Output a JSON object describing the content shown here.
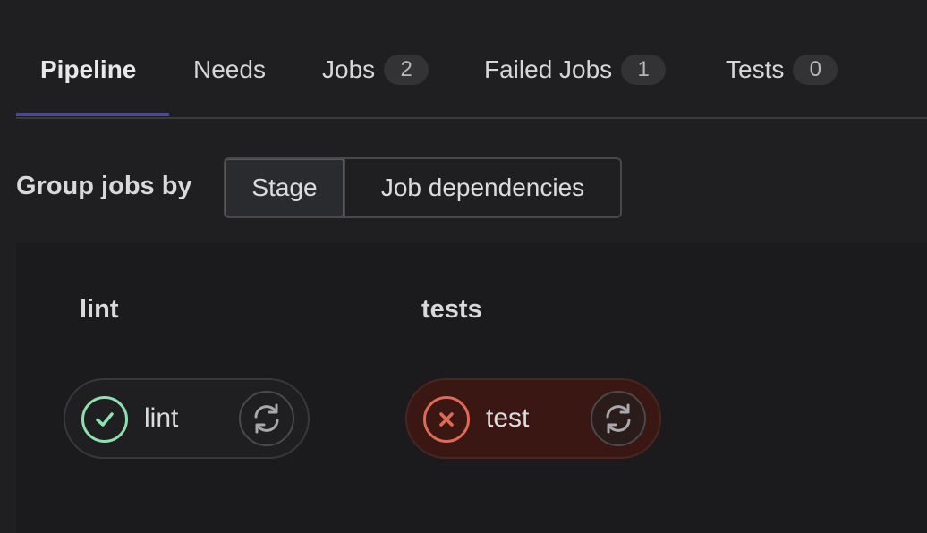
{
  "tabs": [
    {
      "label": "Pipeline",
      "active": true
    },
    {
      "label": "Needs"
    },
    {
      "label": "Jobs",
      "count": "2"
    },
    {
      "label": "Failed Jobs",
      "count": "1"
    },
    {
      "label": "Tests",
      "count": "0"
    }
  ],
  "group_by": {
    "label": "Group jobs by",
    "options": [
      "Stage",
      "Job dependencies"
    ],
    "selected": "Stage"
  },
  "stages": [
    {
      "title": "lint",
      "jobs": [
        {
          "name": "lint",
          "status": "success",
          "icon": "check-icon",
          "retry_icon": "retry-icon"
        }
      ]
    },
    {
      "title": "tests",
      "jobs": [
        {
          "name": "test",
          "status": "failed",
          "icon": "close-icon",
          "retry_icon": "retry-icon"
        }
      ]
    }
  ],
  "colors": {
    "success": "#8fe0ae",
    "failed": "#e06a55",
    "tab_underline": "#4b4a8f"
  }
}
